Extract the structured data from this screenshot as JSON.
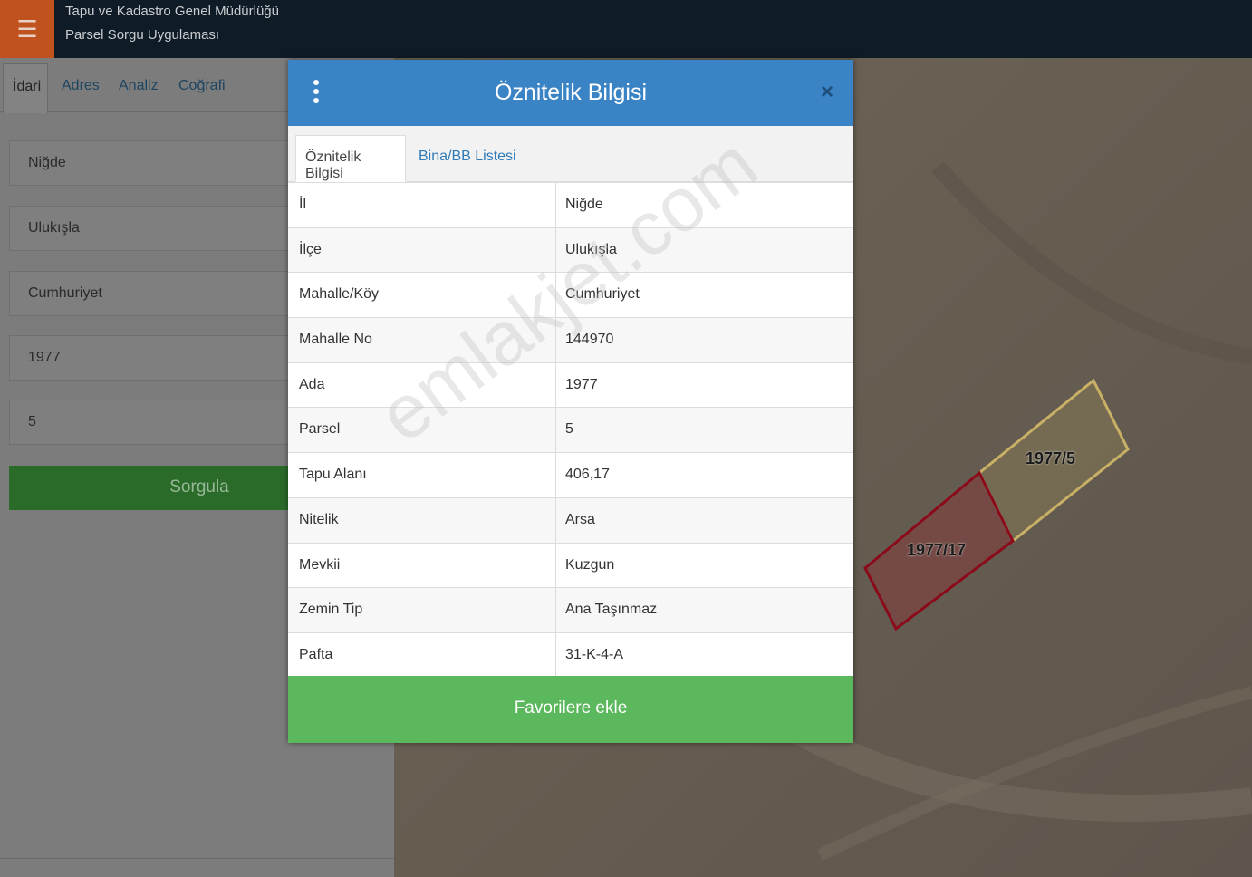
{
  "header": {
    "menu_icon": "hamburger-icon",
    "title_line1": "Tapu ve Kadastro Genel Müdürlüğü",
    "title_line2": "Parsel Sorgu Uygulaması",
    "menu_color": "#c0521f",
    "bg_color": "#0f1b26"
  },
  "left_panel": {
    "tabs": [
      {
        "label": "İdari",
        "active": true
      },
      {
        "label": "Adres",
        "active": false
      },
      {
        "label": "Analiz",
        "active": false
      },
      {
        "label": "Coğrafi",
        "active": false
      }
    ],
    "fields": [
      {
        "name": "il",
        "value": "Niğde"
      },
      {
        "name": "ilce",
        "value": "Ulukışla"
      },
      {
        "name": "mahalle",
        "value": "Cumhuriyet"
      },
      {
        "name": "ada",
        "value": "1977"
      },
      {
        "name": "parsel",
        "value": "5"
      }
    ],
    "query_button": "Sorgula"
  },
  "modal": {
    "title": "Öznitelik Bilgisi",
    "menu_icon": "vertical-dots-icon",
    "close_icon": "close-icon",
    "close_label": "×",
    "tabs": [
      {
        "label": "Öznitelik Bilgisi",
        "active": true
      },
      {
        "label": "Bina/BB Listesi",
        "active": false
      }
    ],
    "rows": [
      {
        "key": "İl",
        "value": "Niğde"
      },
      {
        "key": "İlçe",
        "value": "Ulukışla"
      },
      {
        "key": "Mahalle/Köy",
        "value": "Cumhuriyet"
      },
      {
        "key": "Mahalle No",
        "value": "144970"
      },
      {
        "key": "Ada",
        "value": "1977"
      },
      {
        "key": "Parsel",
        "value": "5"
      },
      {
        "key": "Tapu Alanı",
        "value": "406,17"
      },
      {
        "key": "Nitelik",
        "value": "Arsa"
      },
      {
        "key": "Mevkii",
        "value": "Kuzgun"
      },
      {
        "key": "Zemin Tip",
        "value": "Ana Taşınmaz"
      },
      {
        "key": "Pafta",
        "value": "31-K-4-A"
      }
    ],
    "favorite_button": "Favorilere ekle",
    "header_color": "#3a83c4",
    "button_color": "#5cb85c"
  },
  "map": {
    "parcels": [
      {
        "label": "1977/5",
        "color": "#d8c060"
      },
      {
        "label": "1977/17",
        "color": "#8b0a1a"
      }
    ]
  },
  "watermark": "emlakjet.com"
}
